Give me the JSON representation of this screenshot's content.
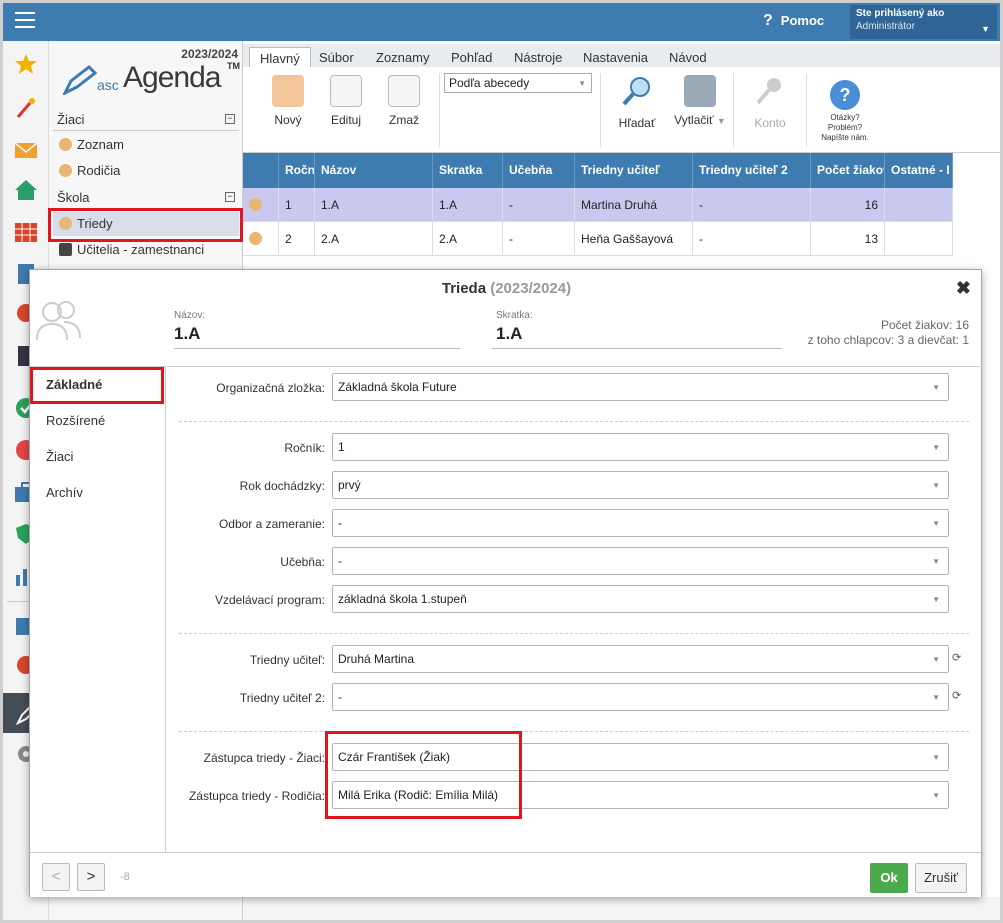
{
  "app": {
    "help_label": "Pomoc",
    "user_line1": "Ste prihlásený ako",
    "user_line2": "Administrátor",
    "year": "2023/2024",
    "logo_asc": "asc",
    "logo_agenda": "Agenda",
    "logo_tm": "TM"
  },
  "nav": {
    "sections": [
      {
        "label": "Žiaci",
        "items": [
          {
            "label": "Zoznam"
          },
          {
            "label": "Rodičia"
          }
        ]
      },
      {
        "label": "Škola",
        "items": [
          {
            "label": "Triedy",
            "selected": true
          },
          {
            "label": "Učitelia - zamestnanci"
          }
        ]
      }
    ]
  },
  "tabs": [
    "Hlavný",
    "Súbor",
    "Zoznamy",
    "Pohľad",
    "Nástroje",
    "Nastavenia",
    "Návod"
  ],
  "ribbon": {
    "new": "Nový",
    "edit": "Edituj",
    "delete": "Zmaž",
    "sort_value": "Podľa abecedy",
    "search": "Hľadať",
    "print": "Vytlačiť",
    "account": "Konto",
    "help_lines": [
      "Otázky?",
      "Problém?",
      "Napíšte nám."
    ]
  },
  "grid": {
    "columns": [
      "Ročn",
      "Názov",
      "Skratka",
      "Učebňa",
      "Triedny učiteľ",
      "Triedny učiteľ 2",
      "Počet žiakov",
      "Ostatné - I"
    ],
    "rows": [
      [
        "1",
        "1.A",
        "1.A",
        "-",
        "Martina Druhá",
        "-",
        "16",
        ""
      ],
      [
        "2",
        "2.A",
        "2.A",
        "-",
        "Heňa Gaššayová",
        "-",
        "13",
        ""
      ]
    ]
  },
  "dialog": {
    "title": "Trieda",
    "title_year": "(2023/2024)",
    "name_label": "Názov:",
    "name_value": "1.A",
    "abbr_label": "Skratka:",
    "abbr_value": "1.A",
    "stats_line1": "Počet žiakov: 16",
    "stats_line2": "z toho chlapcov: 3 a dievčat: 1",
    "side_tabs": [
      "Základné",
      "Rozšírené",
      "Žiaci",
      "Archív"
    ],
    "fields": {
      "org_label": "Organizačná zložka:",
      "org_value": "Základná škola Future",
      "grade_label": "Ročník:",
      "grade_value": "1",
      "attend_label": "Rok dochádzky:",
      "attend_value": "prvý",
      "field_label": "Odbor a zameranie:",
      "field_value": "-",
      "room_label": "Učebňa:",
      "room_value": "-",
      "program_label": "Vzdelávací program:",
      "program_value": "základná škola 1.stupeň",
      "teacher_label": "Triedny učiteľ:",
      "teacher_value": "Druhá Martina",
      "teacher2_label": "Triedny učiteľ 2:",
      "teacher2_value": "-",
      "rep_student_label": "Zástupca triedy - Žiaci:",
      "rep_student_value": "Czár František (Žiak)",
      "rep_parent_label": "Zástupca triedy - Rodičia:",
      "rep_parent_value": "Milá Erika (Rodič: Emília Milá)"
    },
    "footer": {
      "prev": "<",
      "next": ">",
      "id": "-8",
      "ok": "Ok",
      "cancel": "Zrušiť"
    }
  },
  "colors": {
    "header": "#3e7bb0",
    "highlight": "#e0161f",
    "ok": "#4caa4c",
    "row_selected": "#c9c9ef"
  }
}
